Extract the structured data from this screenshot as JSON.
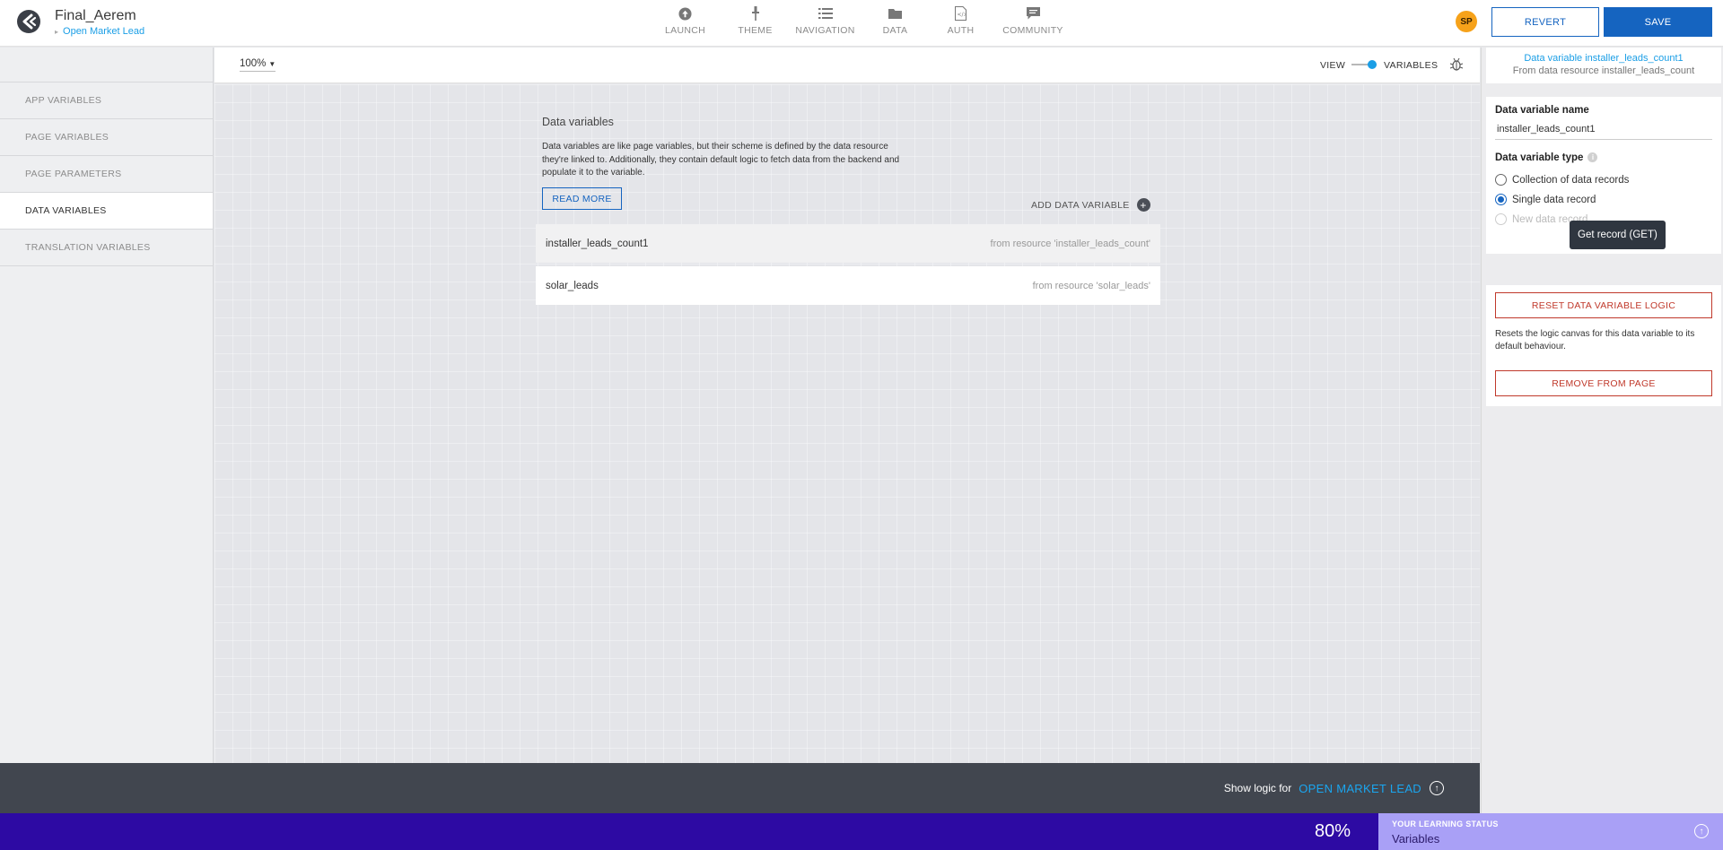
{
  "header": {
    "app_name": "Final_Aerem",
    "page_name": "Open Market Lead",
    "nav": [
      {
        "label": "LAUNCH",
        "icon": "launch-icon"
      },
      {
        "label": "THEME",
        "icon": "theme-icon"
      },
      {
        "label": "NAVIGATION",
        "icon": "navigation-icon"
      },
      {
        "label": "DATA",
        "icon": "data-folder-icon"
      },
      {
        "label": "AUTH",
        "icon": "auth-icon"
      },
      {
        "label": "COMMUNITY",
        "icon": "community-icon"
      }
    ],
    "avatar_initials": "SP",
    "revert_label": "REVERT",
    "save_label": "SAVE"
  },
  "sidebar": {
    "items": [
      {
        "label": "APP VARIABLES"
      },
      {
        "label": "PAGE VARIABLES"
      },
      {
        "label": "PAGE PARAMETERS"
      },
      {
        "label": "DATA VARIABLES"
      },
      {
        "label": "TRANSLATION VARIABLES"
      }
    ],
    "active": "DATA VARIABLES"
  },
  "toolbar": {
    "zoom": "100%",
    "view_label": "VIEW",
    "variables_label": "VARIABLES"
  },
  "canvas": {
    "title": "Data variables",
    "description": "Data variables are like page variables, but their scheme is defined by the data resource they're linked to. Additionally, they contain default logic to fetch data from the backend and populate it to the variable.",
    "read_more_label": "READ MORE",
    "add_label": "ADD DATA VARIABLE",
    "variables": [
      {
        "name": "installer_leads_count1",
        "source": "from resource 'installer_leads_count'"
      },
      {
        "name": "solar_leads",
        "source": "from resource 'solar_leads'"
      }
    ]
  },
  "logic_bar": {
    "prefix": "Show logic for",
    "target": "OPEN MARKET LEAD"
  },
  "learning": {
    "percent": "80%",
    "heading": "YOUR LEARNING STATUS",
    "topic": "Variables"
  },
  "right_panel": {
    "head_title": "Data variable installer_leads_count1",
    "head_subtitle": "From data resource installer_leads_count",
    "name_label": "Data variable name",
    "name_value": "installer_leads_count1",
    "type_label": "Data variable type",
    "type_options": [
      {
        "label": "Collection of data records",
        "checked": false,
        "disabled": false
      },
      {
        "label": "Single data record",
        "checked": true,
        "disabled": false
      },
      {
        "label": "New data record",
        "checked": false,
        "disabled": true
      }
    ],
    "tooltip": "Get record (GET)",
    "reset_label": "RESET DATA VARIABLE LOGIC",
    "reset_desc": "Resets the logic canvas for this data variable to its default behaviour.",
    "remove_label": "REMOVE FROM PAGE"
  },
  "colors": {
    "primary": "#1564c0",
    "accent": "#1a9ee6",
    "danger": "#c0392b",
    "learning_bar": "#2d0aa3",
    "avatar": "#f6a21a"
  }
}
